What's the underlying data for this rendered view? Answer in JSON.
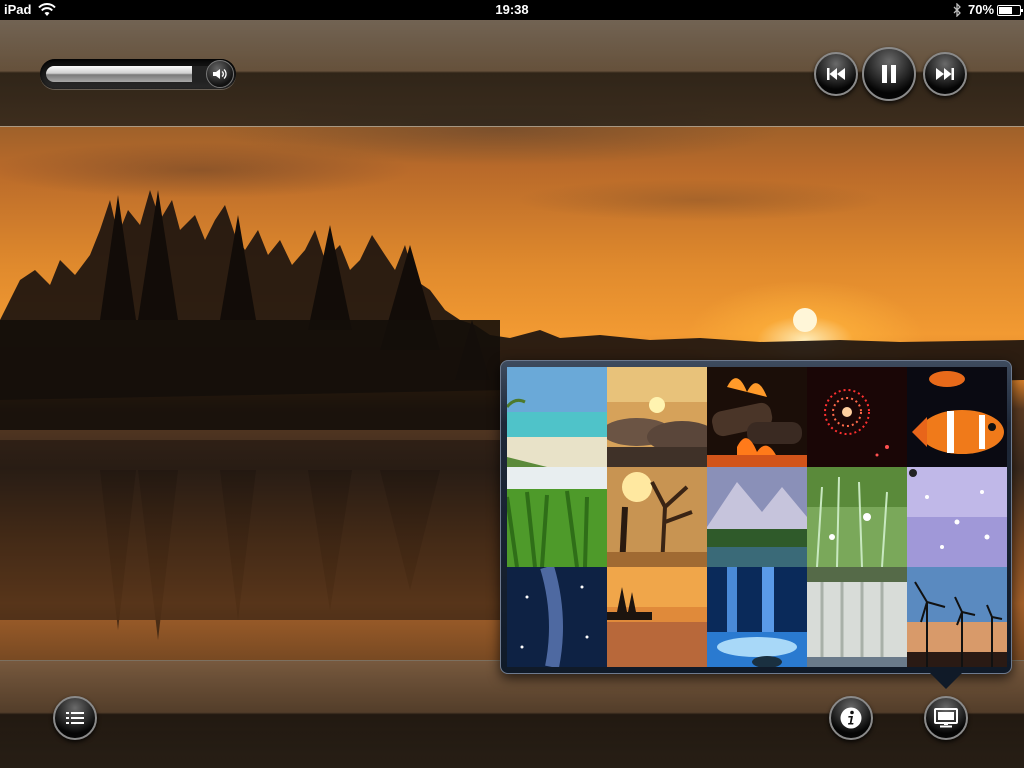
{
  "status_bar": {
    "device": "iPad",
    "time": "19:38",
    "battery": "70%",
    "battery_level": 0.7
  },
  "volume": {
    "level": 0.86,
    "icon": "speaker-icon"
  },
  "playback": {
    "prev_icon": "skip-back-icon",
    "pause_icon": "pause-icon",
    "next_icon": "skip-forward-icon"
  },
  "bottom_bar": {
    "menu_icon": "list-icon",
    "info_icon": "info-icon",
    "display_icon": "monitor-icon"
  },
  "scene_picker": {
    "thumbnails": [
      {
        "id": "tropical-beach",
        "name": "tropical-beach-thumbnail"
      },
      {
        "id": "sunset-clouds",
        "name": "sunset-clouds-thumbnail"
      },
      {
        "id": "fireplace",
        "name": "fireplace-thumbnail"
      },
      {
        "id": "fireworks",
        "name": "fireworks-thumbnail"
      },
      {
        "id": "clownfish",
        "name": "clownfish-thumbnail"
      },
      {
        "id": "grass",
        "name": "grass-thumbnail"
      },
      {
        "id": "autumn-tree",
        "name": "autumn-tree-thumbnail"
      },
      {
        "id": "mountain-lake",
        "name": "mountain-lake-thumbnail"
      },
      {
        "id": "meadow",
        "name": "meadow-thumbnail"
      },
      {
        "id": "raindrops",
        "name": "raindrops-thumbnail"
      },
      {
        "id": "galaxy",
        "name": "galaxy-thumbnail"
      },
      {
        "id": "lake-sunset",
        "name": "lake-sunset-thumbnail"
      },
      {
        "id": "ice-waterfall",
        "name": "ice-waterfall-thumbnail"
      },
      {
        "id": "waterfall",
        "name": "waterfall-thumbnail"
      },
      {
        "id": "wind-turbines",
        "name": "wind-turbines-thumbnail"
      }
    ]
  },
  "colors": {
    "sky_glow": "#f29a32",
    "popover": "#1e2838"
  }
}
